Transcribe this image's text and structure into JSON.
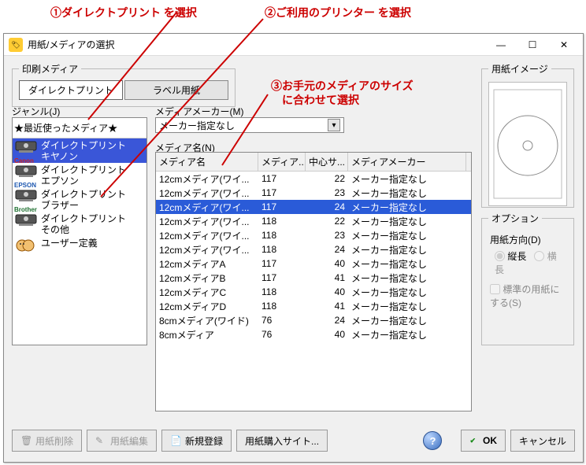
{
  "window": {
    "title": "用紙/メディアの選択"
  },
  "annotations": {
    "a1": "①ダイレクトプリント を選択",
    "a2": "②ご利用のプリンター を選択",
    "a3": "③お手元のメディアのサイズ\n　に合わせて選択"
  },
  "topgroup": {
    "legend": "印刷メディア",
    "tab_direct": "ダイレクトプリント",
    "tab_label": "ラベル用紙"
  },
  "genre": {
    "label": "ジャンル(J)",
    "header": "★最近使ったメディア★",
    "items": [
      {
        "line1": "ダイレクトプリント",
        "line2": "キヤノン",
        "maker": "Canon",
        "maker_color": "#cc2222"
      },
      {
        "line1": "ダイレクトプリント",
        "line2": "エプソン",
        "maker": "EPSON",
        "maker_color": "#1e58b0"
      },
      {
        "line1": "ダイレクトプリント",
        "line2": "ブラザー",
        "maker": "Brother",
        "maker_color": "#1e7030"
      },
      {
        "line1": "ダイレクトプリント",
        "line2": "その他",
        "maker": "",
        "maker_color": "#555"
      },
      {
        "line1": "ユーザー定義",
        "line2": "",
        "maker": "user",
        "maker_color": "#c08030"
      }
    ]
  },
  "maker": {
    "label": "メディアメーカー(M)",
    "value": "メーカー指定なし"
  },
  "media": {
    "label": "メディア名(N)",
    "headers": {
      "c1": "メディア名",
      "c2": "メディア...",
      "c3": "中心サ...",
      "c4": "メディアメーカー"
    },
    "rows": [
      {
        "name": "12cmメディア(ワイ...",
        "diam": "117",
        "center": "22",
        "mk": "メーカー指定なし"
      },
      {
        "name": "12cmメディア(ワイ...",
        "diam": "117",
        "center": "23",
        "mk": "メーカー指定なし"
      },
      {
        "name": "12cmメディア(ワイ...",
        "diam": "117",
        "center": "24",
        "mk": "メーカー指定なし"
      },
      {
        "name": "12cmメディア(ワイ...",
        "diam": "118",
        "center": "22",
        "mk": "メーカー指定なし"
      },
      {
        "name": "12cmメディア(ワイ...",
        "diam": "118",
        "center": "23",
        "mk": "メーカー指定なし"
      },
      {
        "name": "12cmメディア(ワイ...",
        "diam": "118",
        "center": "24",
        "mk": "メーカー指定なし"
      },
      {
        "name": "12cmメディアA",
        "diam": "117",
        "center": "40",
        "mk": "メーカー指定なし"
      },
      {
        "name": "12cmメディアB",
        "diam": "117",
        "center": "41",
        "mk": "メーカー指定なし"
      },
      {
        "name": "12cmメディアC",
        "diam": "118",
        "center": "40",
        "mk": "メーカー指定なし"
      },
      {
        "name": "12cmメディアD",
        "diam": "118",
        "center": "41",
        "mk": "メーカー指定なし"
      },
      {
        "name": "8cmメディア(ワイド)",
        "diam": "76",
        "center": "24",
        "mk": "メーカー指定なし"
      },
      {
        "name": "8cmメディア",
        "diam": "76",
        "center": "40",
        "mk": "メーカー指定なし"
      }
    ],
    "selected_index": 2
  },
  "preview": {
    "legend": "用紙イメージ"
  },
  "options": {
    "legend": "オプション",
    "orient_label": "用紙方向(D)",
    "orient_v": "縦長",
    "orient_h": "横長",
    "std_paper": "標準の用紙にする(S)"
  },
  "footer": {
    "delete": "用紙削除",
    "edit": "用紙編集",
    "new": "新規登録",
    "purchase": "用紙購入サイト...",
    "ok": "OK",
    "cancel": "キャンセル"
  }
}
